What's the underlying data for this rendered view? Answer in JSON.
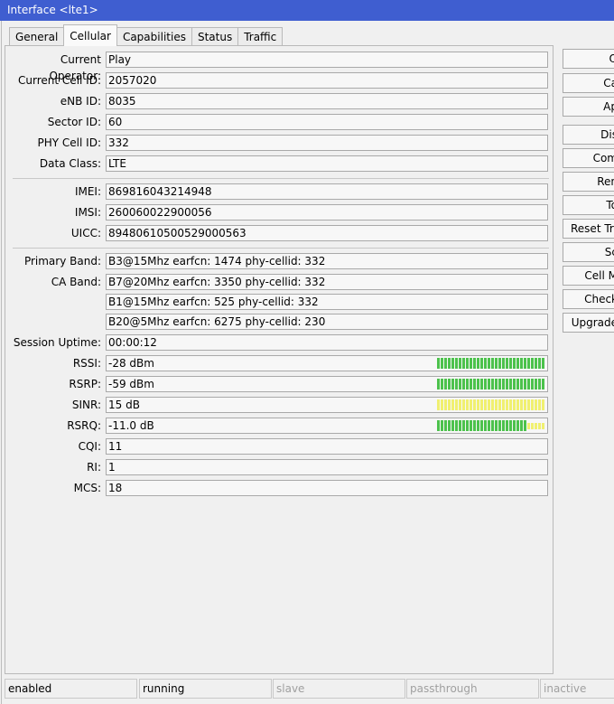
{
  "window": {
    "title": "Interface <lte1>"
  },
  "tabs": [
    "General",
    "Cellular",
    "Capabilities",
    "Status",
    "Traffic"
  ],
  "active_tab": "Cellular",
  "fields": {
    "current_operator": {
      "label": "Current Operator:",
      "value": "Play"
    },
    "current_cell_id": {
      "label": "Current Cell ID:",
      "value": "2057020"
    },
    "enb_id": {
      "label": "eNB ID:",
      "value": "8035"
    },
    "sector_id": {
      "label": "Sector ID:",
      "value": "60"
    },
    "phy_cell_id": {
      "label": "PHY Cell ID:",
      "value": "332"
    },
    "data_class": {
      "label": "Data Class:",
      "value": "LTE"
    },
    "imei": {
      "label": "IMEI:",
      "value": "869816043214948"
    },
    "imsi": {
      "label": "IMSI:",
      "value": "260060022900056"
    },
    "uicc": {
      "label": "UICC:",
      "value": "89480610500529000563"
    },
    "primary_band": {
      "label": "Primary Band:",
      "value": "B3@15Mhz earfcn: 1474 phy-cellid: 332"
    },
    "ca_band": {
      "label": "CA Band:",
      "values": [
        "B7@20Mhz earfcn: 3350 phy-cellid: 332",
        "B1@15Mhz earfcn: 525 phy-cellid: 332",
        "B20@5Mhz earfcn: 6275 phy-cellid: 230"
      ]
    },
    "session_uptime": {
      "label": "Session Uptime:",
      "value": "00:00:12"
    },
    "rssi": {
      "label": "RSSI:",
      "value": "-28 dBm",
      "level": 1.0,
      "color": "#4cc24c"
    },
    "rsrp": {
      "label": "RSRP:",
      "value": "-59 dBm",
      "level": 1.0,
      "color": "#4cc24c"
    },
    "sinr": {
      "label": "SINR:",
      "value": "15 dB",
      "level": 1.0,
      "color": "#f0f070"
    },
    "rsrq": {
      "label": "RSRQ:",
      "value": "-11.0 dB",
      "level": 0.83,
      "color": "#4cc24c",
      "rest_color": "#f0f070"
    },
    "cqi": {
      "label": "CQI:",
      "value": "11"
    },
    "ri": {
      "label": "RI:",
      "value": "1"
    },
    "mcs": {
      "label": "MCS:",
      "value": "18"
    }
  },
  "buttons": [
    "O",
    "Ca",
    "Ap",
    "Dis",
    "Com",
    "Ren",
    "To",
    "Reset Traf",
    "Sc",
    "Cell M",
    "Check",
    "Upgrade"
  ],
  "status": [
    "enabled",
    "running",
    "slave",
    "passthrough",
    "inactive"
  ]
}
